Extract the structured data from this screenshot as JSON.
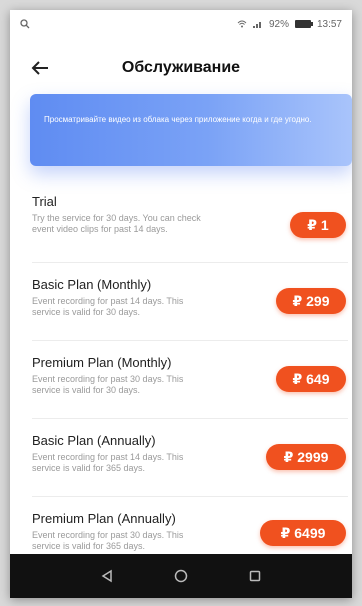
{
  "status_bar": {
    "left_icon": "search-icon",
    "signal_text": "вР’ .ıl",
    "battery_text": "92%",
    "time": "13:57"
  },
  "header": {
    "title": "Обслуживание",
    "back_icon": "arrow-left-icon"
  },
  "banner": {
    "text": "Просматривайте видео из облака через приложение когда и где угодно."
  },
  "plans": [
    {
      "name": "Trial",
      "description": "Try the service for 30 days. You can check event video clips for past 14 days.",
      "price": "₽ 1"
    },
    {
      "name": "Basic Plan (Monthly)",
      "description": "Event recording for past 14 days. This service is valid for 30 days.",
      "price": "₽ 299"
    },
    {
      "name": "Premium Plan (Monthly)",
      "description": "Event recording for past 30 days. This service is valid for 30 days.",
      "price": "₽ 649"
    },
    {
      "name": "Basic Plan (Annually)",
      "description": "Event recording for past 14 days. This service is valid for 365 days.",
      "price": "₽ 2999"
    },
    {
      "name": "Premium Plan (Annually)",
      "description": "Event recording for past 30 days. This service is valid for 365 days.",
      "price": "₽ 6499"
    }
  ],
  "nav_bar": {
    "back_icon": "triangle-back-icon",
    "home_icon": "circle-home-icon",
    "recents_icon": "square-recents-icon"
  },
  "colors": {
    "accent": "#f0511f",
    "banner_start": "#5f8cf2",
    "banner_end": "#a9c4fb",
    "nav_bg": "#111111"
  }
}
